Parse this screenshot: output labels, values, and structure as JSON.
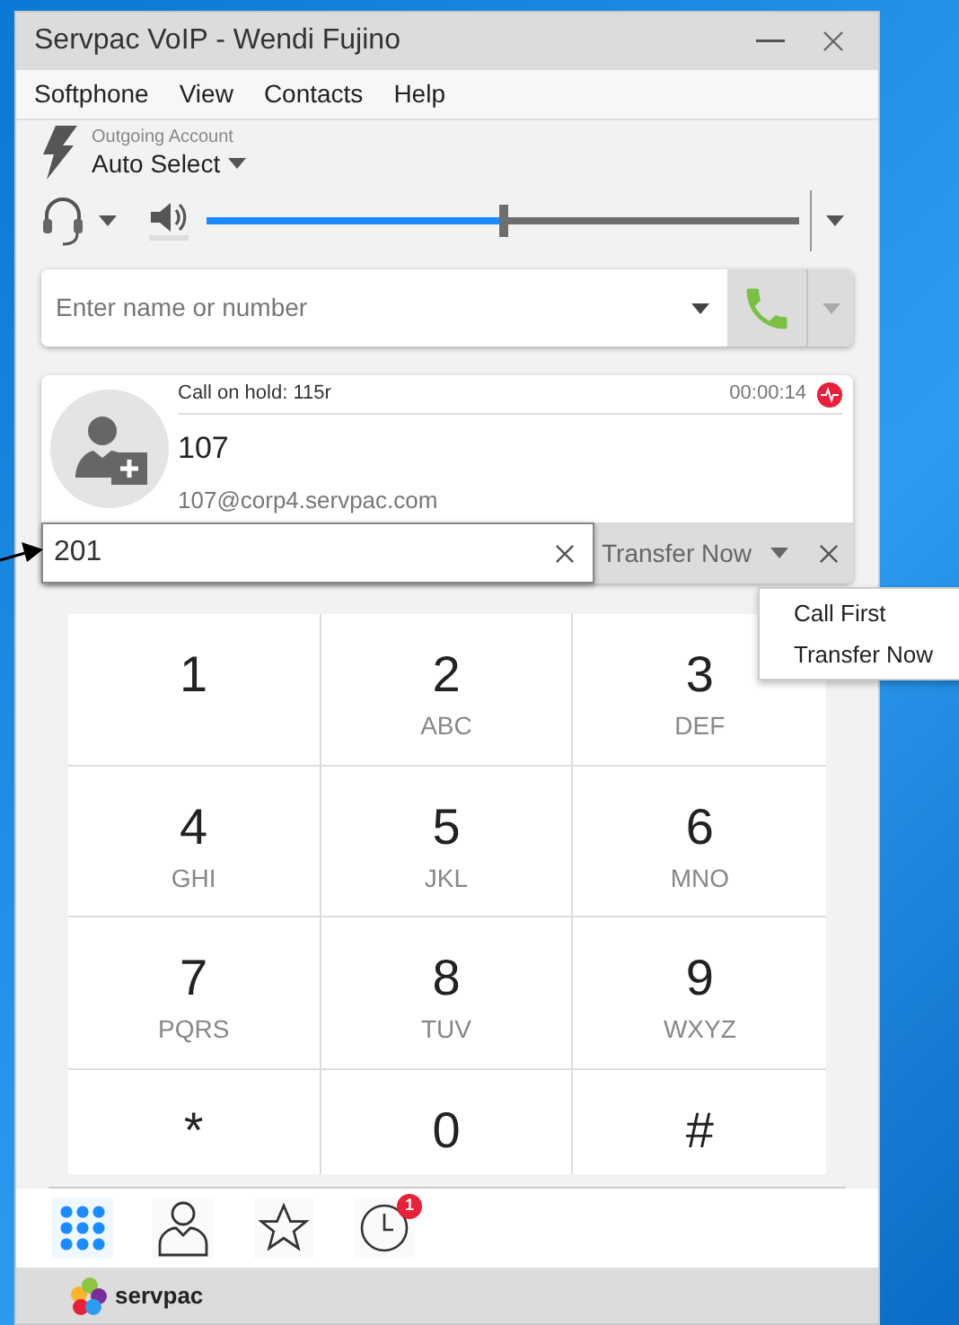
{
  "window": {
    "title": "Servpac VoIP - Wendi Fujino"
  },
  "menu": [
    "Softphone",
    "View",
    "Contacts",
    "Help"
  ],
  "account": {
    "label": "Outgoing Account",
    "value": "Auto Select"
  },
  "volume": {
    "level": 0.5
  },
  "dial": {
    "placeholder": "Enter name or number"
  },
  "call": {
    "status": "Call on hold: 115r",
    "duration": "00:00:14",
    "name": "107",
    "address": "107@corp4.servpac.com"
  },
  "transfer": {
    "value": "201",
    "mode": "Transfer Now"
  },
  "transfer_menu": [
    "Call First",
    "Transfer Now"
  ],
  "keypad": [
    {
      "digit": "1"
    },
    {
      "digit": "2",
      "letters": "ABC"
    },
    {
      "digit": "3",
      "letters": "DEF"
    },
    {
      "digit": "4",
      "letters": "GHI"
    },
    {
      "digit": "5",
      "letters": "JKL"
    },
    {
      "digit": "6",
      "letters": "MNO"
    },
    {
      "digit": "7",
      "letters": "PQRS"
    },
    {
      "digit": "8",
      "letters": "TUV"
    },
    {
      "digit": "9",
      "letters": "WXYZ"
    },
    {
      "digit": "*"
    },
    {
      "digit": "0"
    },
    {
      "digit": "#"
    }
  ],
  "nav": [
    {
      "kind": "keypad",
      "selected": true
    },
    {
      "kind": "contacts",
      "selected": false
    },
    {
      "kind": "favorites",
      "selected": false
    },
    {
      "kind": "history",
      "selected": false,
      "badge": "1"
    }
  ],
  "brand": "servpac"
}
